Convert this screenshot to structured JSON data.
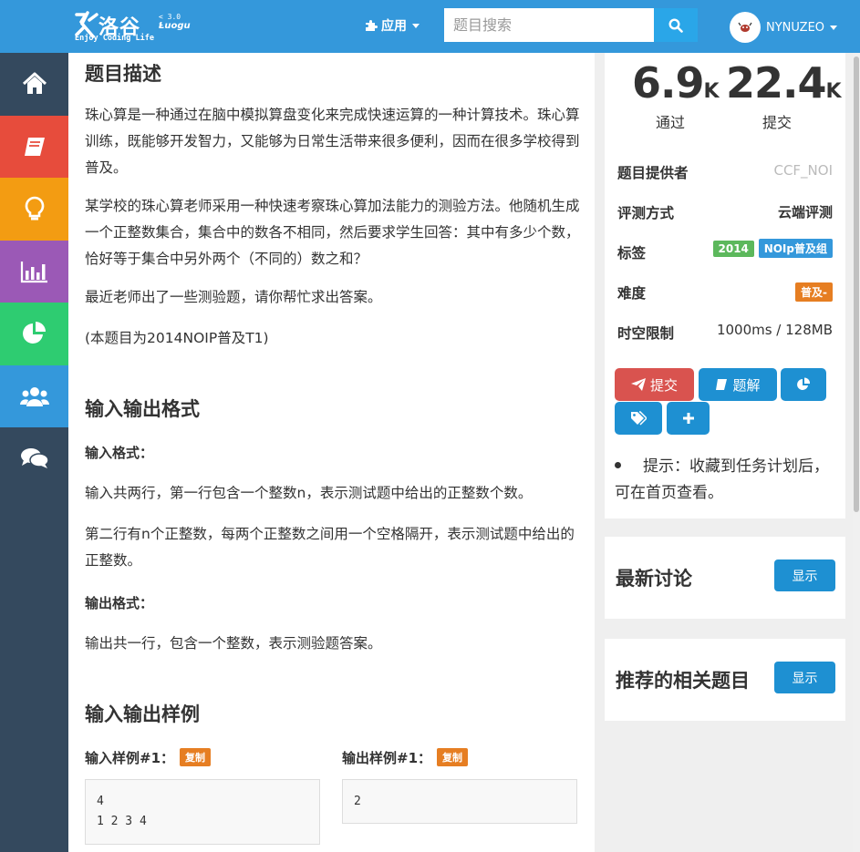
{
  "header": {
    "logo_text": "洛谷",
    "logo_latin": "Luogu",
    "logo_version": "< 3.0 >",
    "logo_slogan": "Enjoy Coding Life",
    "apps_label": "应用",
    "search_placeholder": "题目搜索",
    "username": "NYNUZEO"
  },
  "sidebar": {
    "items": [
      {
        "icon": "home-icon",
        "color": "#34495e"
      },
      {
        "icon": "book-icon",
        "color": "#e74c3c"
      },
      {
        "icon": "lightbulb-icon",
        "color": "#f39c12"
      },
      {
        "icon": "bar-chart-icon",
        "color": "#9b59b6"
      },
      {
        "icon": "pie-chart-icon",
        "color": "#2ecc71"
      },
      {
        "icon": "users-icon",
        "color": "#3498db"
      },
      {
        "icon": "comments-icon",
        "color": "#34495e"
      }
    ]
  },
  "problem": {
    "desc_title": "题目描述",
    "desc_p1": "珠心算是一种通过在脑中模拟算盘变化来完成快速运算的一种计算技术。珠心算训练，既能够开发智力，又能够为日常生活带来很多便利，因而在很多学校得到普及。",
    "desc_p2": "某学校的珠心算老师采用一种快速考察珠心算加法能力的测验方法。他随机生成一个正整数集合，集合中的数各不相同，然后要求学生回答：其中有多少个数，恰好等于集合中另外两个（不同的）数之和？",
    "desc_p3": "最近老师出了一些测验题，请你帮忙求出答案。",
    "desc_p4": "(本题目为2014NOIP普及T1)",
    "io_title": "输入输出格式",
    "input_format_label": "输入格式：",
    "input_p1": "输入共两行，第一行包含一个整数n，表示测试题中给出的正整数个数。",
    "input_p2": "第二行有n个正整数，每两个正整数之间用一个空格隔开，表示测试题中给出的正整数。",
    "output_format_label": "输出格式：",
    "output_p1": "输出共一行，包含一个整数，表示测验题答案。",
    "sample_title": "输入输出样例",
    "input_sample_label": "输入样例#1：",
    "output_sample_label": "输出样例#1：",
    "copy_label": "复制",
    "input_sample": "4\n1 2 3 4",
    "output_sample": "2"
  },
  "stats": {
    "passed_value": "6.9",
    "passed_unit": "K",
    "passed_label": "通过",
    "submitted_value": "22.4",
    "submitted_unit": "K",
    "submitted_label": "提交"
  },
  "info": {
    "provider_label": "题目提供者",
    "provider_value": "CCF_NOI",
    "judge_label": "评测方式",
    "judge_value": "云端评测",
    "tags_label": "标签",
    "tags": [
      "2014",
      "NOIp普及组"
    ],
    "difficulty_label": "难度",
    "difficulty_value": "普及-",
    "limit_label": "时空限制",
    "limit_value": "1000ms / 128MB"
  },
  "actions": {
    "submit_label": "提交",
    "solution_label": "题解"
  },
  "tip": "提示：收藏到任务计划后，可在首页查看。",
  "discuss": {
    "title": "最新讨论",
    "show_label": "显示"
  },
  "related": {
    "title": "推荐的相关题目",
    "show_label": "显示"
  },
  "colors": {
    "primary": "#3498db",
    "submit_red": "#d9534f",
    "button_blue": "#1e90d2",
    "tag_green": "#5cb85c",
    "tag_blue": "#3498db",
    "difficulty_orange": "#e67e22"
  }
}
